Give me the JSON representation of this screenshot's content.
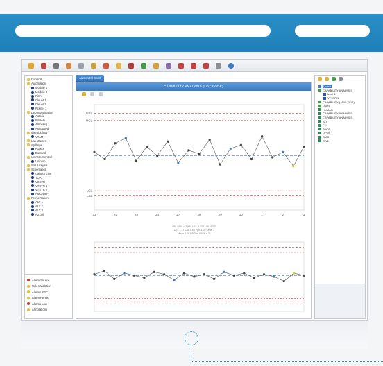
{
  "banner": {
    "pill_a": "",
    "pill_b": ""
  },
  "window": {
    "tab_label": "Aa Control Chart",
    "chart_header": "CAPABILITY ANALYSIS (LOT CODE)",
    "left_tree": [
      {
        "label": "Controls",
        "kind": "folder"
      },
      {
        "label": "Automation",
        "kind": "folder"
      },
      {
        "label": "Module 1",
        "kind": "dot"
      },
      {
        "label": "Module 2",
        "kind": "dot"
      },
      {
        "label": "Rinn",
        "kind": "dot"
      },
      {
        "label": "Cleuet 1",
        "kind": "dot"
      },
      {
        "label": "Cleuet 2",
        "kind": "dot"
      },
      {
        "label": "Pcknet 1",
        "kind": "dot"
      },
      {
        "label": "Decontamination",
        "kind": "folder"
      },
      {
        "label": "Autoriz",
        "kind": "dot"
      },
      {
        "label": "Rinseln",
        "kind": "dot"
      },
      {
        "label": "Ampliseq",
        "kind": "dot"
      },
      {
        "label": "Annotated",
        "kind": "dot"
      },
      {
        "label": "Microbiology",
        "kind": "folder"
      },
      {
        "label": "VTAM",
        "kind": "dot"
      },
      {
        "label": "Lab Wastes",
        "kind": "folder"
      },
      {
        "label": "Spillings",
        "kind": "folder"
      },
      {
        "label": "DelTet",
        "kind": "dot"
      },
      {
        "label": "Dumfed",
        "kind": "dot"
      },
      {
        "label": "Uninstrumented",
        "kind": "folder"
      },
      {
        "label": "Uninom",
        "kind": "dot"
      },
      {
        "label": "Soil Analysis",
        "kind": "folder"
      },
      {
        "label": "Schematics",
        "kind": "folder"
      },
      {
        "label": "Cabacs Line",
        "kind": "dot"
      },
      {
        "label": "TOA",
        "kind": "dot"
      },
      {
        "label": "VSCTR",
        "kind": "dot"
      },
      {
        "label": "VTSTR 1",
        "kind": "dot"
      },
      {
        "label": "VTSTR 2",
        "kind": "dot"
      },
      {
        "label": "AMONIFF",
        "kind": "dot"
      },
      {
        "label": "Fermentation",
        "kind": "folder"
      },
      {
        "label": "ALT 1",
        "kind": "dot"
      },
      {
        "label": "ALT 2",
        "kind": "dot"
      },
      {
        "label": "ALT 3",
        "kind": "dot"
      },
      {
        "label": "RZ1vill",
        "kind": "dot"
      }
    ],
    "legend": [
      {
        "label": "Alarm Source",
        "color": "#c0392b"
      },
      {
        "label": "Rules Violation",
        "color": "#e6c02a"
      },
      {
        "label": "Alarms SPC",
        "color": "#e6c02a"
      },
      {
        "label": "Alarm Persist",
        "color": "#e6c02a"
      },
      {
        "label": "Alarms Low",
        "color": "#c0392b"
      },
      {
        "label": "Annotations",
        "color": "#e6c02a"
      }
    ],
    "right_tree": [
      {
        "label": "Query",
        "kind": "green",
        "selected": true
      },
      {
        "label": "CAPABILITY ANALYSIS",
        "kind": "green"
      },
      {
        "label": "level 1",
        "kind": "blue"
      },
      {
        "label": "VTSTR 1",
        "kind": "blue"
      },
      {
        "label": "CAPABILITY (ANALYSIS)",
        "kind": "green"
      },
      {
        "label": "Query",
        "kind": "green"
      },
      {
        "label": "HUMAN",
        "kind": "bar"
      },
      {
        "label": "CAPABILITY ANALYSIS",
        "kind": "bar"
      },
      {
        "label": "CAPABILITY ANALYSIS",
        "kind": "bar"
      },
      {
        "label": "ALT",
        "kind": "bar"
      },
      {
        "label": "PH",
        "kind": "bar"
      },
      {
        "label": "PHOT",
        "kind": "bar"
      },
      {
        "label": "OPNS",
        "kind": "bar"
      },
      {
        "label": "OMB",
        "kind": "bar"
      },
      {
        "label": "BW1",
        "kind": "bar"
      }
    ],
    "caption_lines": [
      "LSL 4000 = 3.978 UCL 4.021 USL 4.025",
      "CpT 1.17 Cpk 1.09 PpK 1.02 Level 1",
      "Mean 4.001 StDev 0.008 n 21"
    ]
  },
  "chart_data": [
    {
      "type": "line",
      "x": [
        "23",
        "24",
        "25",
        "26",
        "27",
        "28",
        "29",
        "30",
        "1",
        "2",
        "3"
      ],
      "y_tick_labels": [
        "USL",
        "UCL",
        "LCL",
        "LSL"
      ],
      "series": [
        {
          "values": [
            4.003,
            3.999,
            4.008,
            4.011,
            3.998,
            4.006,
            4.001,
            4.009,
            3.997,
            4.004,
            4.002,
            4.01,
            3.996,
            4.005,
            4.007,
            3.999,
            4.012,
            4.0,
            4.003,
            3.995,
            4.006
          ]
        }
      ],
      "limits": {
        "usl": 4.025,
        "ucl": 4.021,
        "center": 4.001,
        "lcl": 3.981,
        "lsl": 3.978
      },
      "ylim": [
        3.97,
        4.03
      ]
    },
    {
      "type": "line",
      "series": [
        {
          "values": [
            4.002,
            4.005,
            3.998,
            4.003,
            4.001,
            3.999,
            4.004,
            4.002,
            3.997,
            4.003,
            4.0,
            4.002,
            3.998,
            4.004,
            4.001,
            4.003,
            3.999,
            4.002,
            4.0,
            3.996,
            4.003,
            4.001
          ]
        }
      ],
      "limits": {
        "usl": 4.025,
        "ucl": 4.021,
        "center": 4.001,
        "lcl": 3.981,
        "lsl": 3.978
      },
      "ylim": [
        3.97,
        4.03
      ]
    }
  ]
}
